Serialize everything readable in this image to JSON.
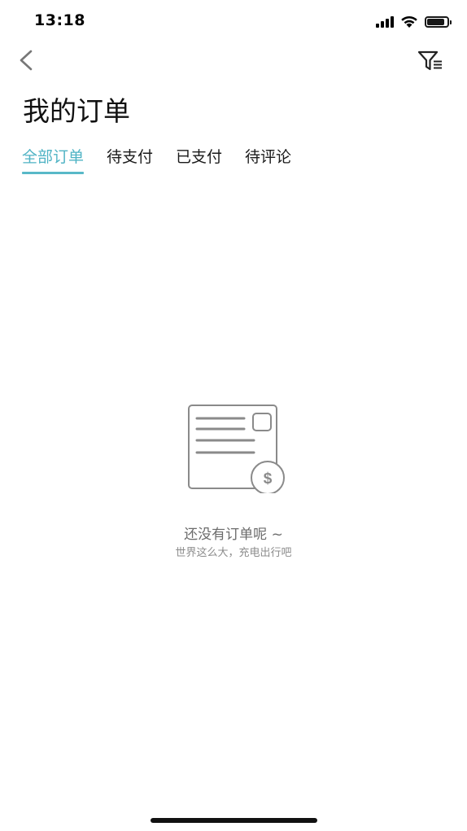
{
  "status_bar": {
    "time": "13:18",
    "battery_level": 0.9,
    "icons": [
      "signal-icon",
      "wifi-icon",
      "battery-icon"
    ]
  },
  "nav": {
    "back_icon": "chevron-left-icon",
    "filter_icon": "filter-list-icon"
  },
  "page": {
    "title": "我的订单"
  },
  "tabs": [
    {
      "label": "全部订单",
      "active": true
    },
    {
      "label": "待支付",
      "active": false
    },
    {
      "label": "已支付",
      "active": false
    },
    {
      "label": "待评论",
      "active": false
    }
  ],
  "empty_state": {
    "icon": "empty-order-receipt-icon",
    "title": "还没有订单呢 ~",
    "subtitle": "世界这么大，充电出行吧"
  },
  "colors": {
    "accent": "#58b8c8",
    "text_primary": "#111111",
    "text_muted": "#8c8c8c"
  }
}
